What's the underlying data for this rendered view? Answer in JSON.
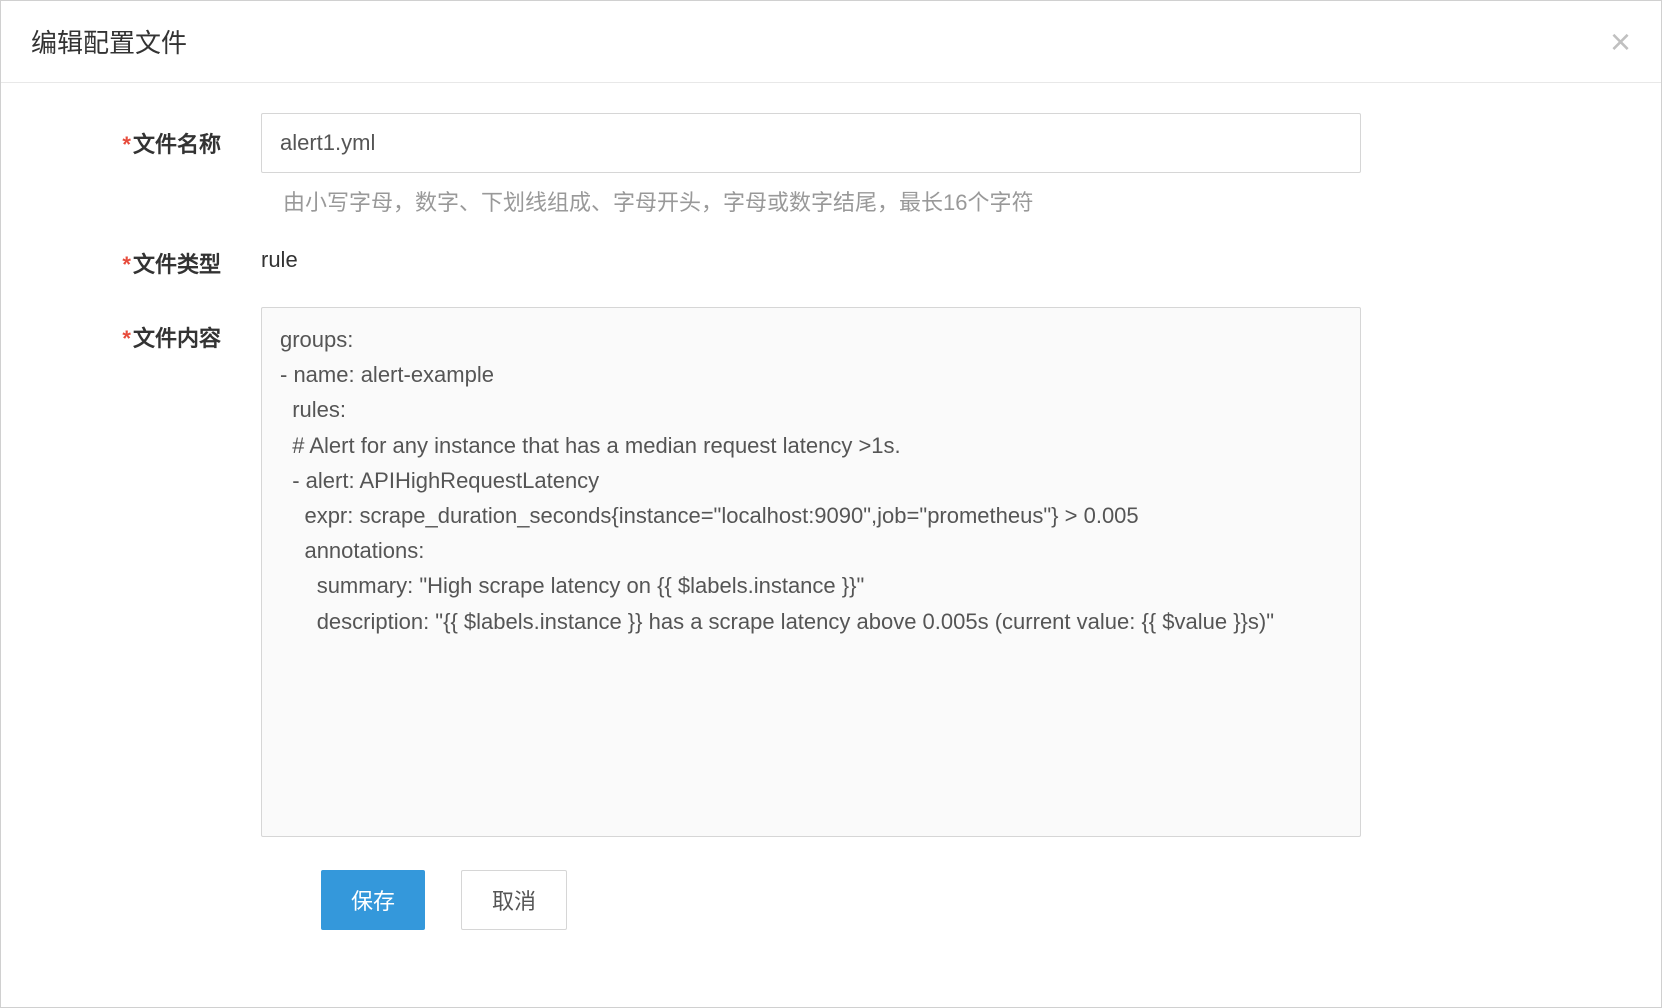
{
  "modal": {
    "title": "编辑配置文件"
  },
  "form": {
    "filename": {
      "label": "文件名称",
      "value": "alert1.yml",
      "help": "由小写字母，数字、下划线组成、字母开头，字母或数字结尾，最长16个字符"
    },
    "filetype": {
      "label": "文件类型",
      "value": "rule"
    },
    "filecontent": {
      "label": "文件内容",
      "value": "groups:\n- name: alert-example\n  rules:\n  # Alert for any instance that has a median request latency >1s.\n  - alert: APIHighRequestLatency\n    expr: scrape_duration_seconds{instance=\"localhost:9090\",job=\"prometheus\"} > 0.005\n    annotations:\n      summary: \"High scrape latency on {{ $labels.instance }}\"\n      description: \"{{ $labels.instance }} has a scrape latency above 0.005s (current value: {{ $value }}s)\""
    }
  },
  "buttons": {
    "save": "保存",
    "cancel": "取消"
  }
}
